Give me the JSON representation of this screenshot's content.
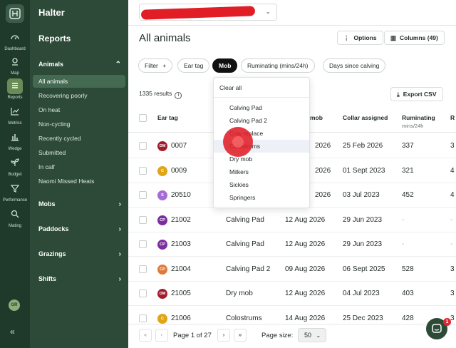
{
  "rail": {
    "items": [
      {
        "label": "Dashboard",
        "icon": "gauge-icon"
      },
      {
        "label": "Map",
        "icon": "map-pin-icon"
      },
      {
        "label": "Reports",
        "icon": "list-icon",
        "active": true
      },
      {
        "label": "Metrics",
        "icon": "line-chart-icon"
      },
      {
        "label": "Wedge",
        "icon": "bar-chart-icon"
      },
      {
        "label": "Budget",
        "icon": "sprout-icon"
      },
      {
        "label": "Performance",
        "icon": "funnel-icon"
      },
      {
        "label": "Mating",
        "icon": "search-heart-icon"
      }
    ],
    "avatar": "GR",
    "collapse": "«"
  },
  "nav": {
    "brand": "Halter",
    "section": "Reports",
    "animals_group": "Animals",
    "animals_items": [
      "All animals",
      "Recovering poorly",
      "On heat",
      "Non-cycling",
      "Recently cycled",
      "Submitted",
      "In calf",
      "Naomi Missed Heats"
    ],
    "groups": [
      "Mobs",
      "Paddocks",
      "Grazings",
      "Shifts"
    ]
  },
  "header": {
    "title": "All animals",
    "options_label": "Options",
    "columns_label": "Columns (49)"
  },
  "filters": {
    "filter_label": "Filter",
    "chips": [
      "Ear tag",
      "Mob",
      "Ruminating (mins/24h)",
      "Days since calving"
    ]
  },
  "results": {
    "count": "1335 results",
    "export_label": "Export CSV"
  },
  "table": {
    "headers": {
      "ear_tag": "Ear tag",
      "mob": "mob",
      "collar": "Collar assigned",
      "ruminating": "Ruminating",
      "ruminating_sub": "mins/24h",
      "extra": "R"
    },
    "rows": [
      {
        "badge": "DM",
        "color": "#a11d2a",
        "tag": "0007",
        "mob": "",
        "date": "2026",
        "collar": "25 Feb 2026",
        "rum": "337",
        "extra": "3"
      },
      {
        "badge": "C",
        "color": "#e0a516",
        "tag": "0009",
        "mob": "",
        "date": "2026",
        "collar": "01 Sept 2023",
        "rum": "321",
        "extra": "4"
      },
      {
        "badge": "S",
        "color": "#a66cd6",
        "tag": "20510",
        "mob": "",
        "date": "2026",
        "collar": "03 Jul 2023",
        "rum": "452",
        "extra": "4"
      },
      {
        "badge": "CP",
        "color": "#7a2f9e",
        "tag": "21002",
        "mob": "Calving Pad",
        "date": "12 Aug 2026",
        "collar": "29 Jun 2023",
        "rum": "-",
        "extra": "-"
      },
      {
        "badge": "CP",
        "color": "#7a2f9e",
        "tag": "21003",
        "mob": "Calving Pad",
        "date": "12 Aug 2026",
        "collar": "29 Jun 2023",
        "rum": "-",
        "extra": "-"
      },
      {
        "badge": "CP",
        "color": "#e07a3a",
        "tag": "21004",
        "mob": "Calving Pad 2",
        "date": "09 Aug 2026",
        "collar": "06 Sept 2025",
        "rum": "528",
        "extra": "3"
      },
      {
        "badge": "DM",
        "color": "#a11d2a",
        "tag": "21005",
        "mob": "Dry mob",
        "date": "12 Aug 2026",
        "collar": "04 Jul 2023",
        "rum": "403",
        "extra": "3"
      },
      {
        "badge": "C",
        "color": "#e0a516",
        "tag": "21006",
        "mob": "Colostrums",
        "date": "14 Aug 2026",
        "collar": "25 Dec 2023",
        "rum": "428",
        "extra": "3"
      }
    ]
  },
  "dropdown": {
    "clear_all": "Clear all",
    "options": [
      "Calving Pad",
      "Calving Pad 2",
      "Cow replace",
      "Colostrums",
      "Dry mob",
      "Milkers",
      "Sickies",
      "Springers"
    ]
  },
  "pagination": {
    "first": "«",
    "prev": "‹",
    "page_text": "Page 1 of 27",
    "next": "›",
    "last": "»",
    "size_label": "Page size:",
    "size_value": "50"
  },
  "chat": {
    "badge": "1"
  }
}
